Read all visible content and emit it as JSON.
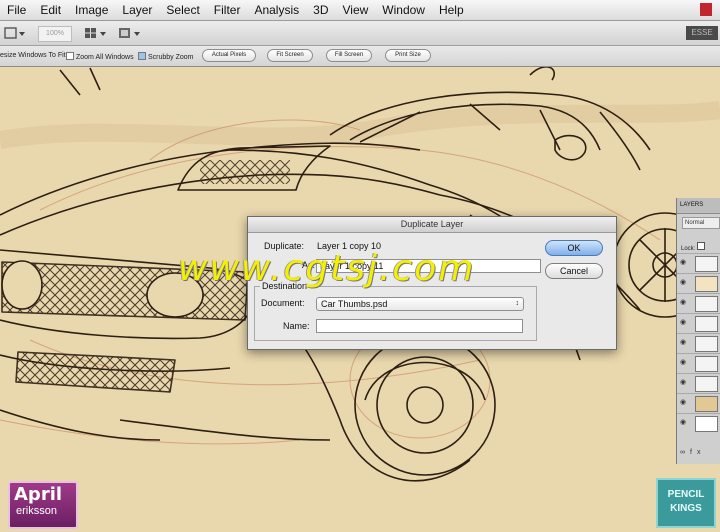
{
  "menubar": {
    "items": [
      "File",
      "Edit",
      "Image",
      "Layer",
      "Select",
      "Filter",
      "Analysis",
      "3D",
      "View",
      "Window",
      "Help"
    ]
  },
  "appbar": {
    "zoom_value": "100%",
    "workspace": "ESSE"
  },
  "options_bar": {
    "resize_windows_label": "esize Windows To Fit",
    "zoom_all_windows_label": "Zoom All Windows",
    "zoom_all_windows_checked": false,
    "scrubby_zoom_label": "Scrubby Zoom",
    "scrubby_zoom_checked": true,
    "buttons": [
      "Actual Pixels",
      "Fit Screen",
      "Fill Screen",
      "Print Size"
    ]
  },
  "dialog": {
    "title": "Duplicate Layer",
    "duplicate_label": "Duplicate:",
    "duplicate_value": "Layer 1 copy 10",
    "as_label": "As:",
    "as_value": "Layer 1 copy 11",
    "destination_label": "Destination",
    "document_label": "Document:",
    "document_value": "Car Thumbs.psd",
    "name_label": "Name:",
    "name_value": "",
    "ok_label": "OK",
    "cancel_label": "Cancel"
  },
  "layers_panel": {
    "tab_label": "LAYERS",
    "blend_mode": "Normal",
    "lock_label": "Lock:",
    "fx_label": "fx"
  },
  "watermark": "www.cgtsj.com",
  "branding": {
    "left_top": "April",
    "left_bottom": "eriksson",
    "right_top": "PENCIL",
    "right_bottom": "KINGS"
  },
  "colors": {
    "canvas_paper": "#e9d7ad",
    "watermark": "#f4f000",
    "ok_default": "#7fb0ea",
    "april_purple": "#8a2d7a",
    "pencil_teal": "#3a9a9c"
  }
}
